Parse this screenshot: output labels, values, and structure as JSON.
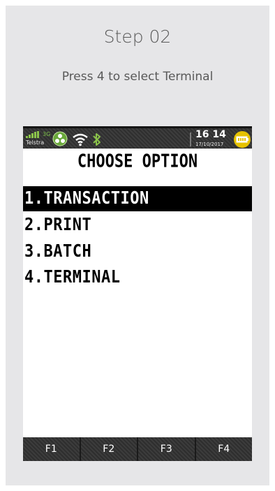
{
  "step": {
    "title": "Step 02",
    "description": "Press 4 to select Terminal"
  },
  "status_bar": {
    "carrier": "Telstra",
    "network_type": "3G",
    "time": "16 14",
    "date": "17/10/2017",
    "icons": [
      "signal-icon",
      "network-badge-icon",
      "wifi-icon",
      "bluetooth-icon",
      "battery-icon"
    ],
    "colors": {
      "bar": "#333333",
      "accent": "#8bc34a",
      "battery": "#e6c200"
    }
  },
  "menu": {
    "title": "CHOOSE OPTION",
    "items": [
      {
        "label": "1.TRANSACTION",
        "selected": true
      },
      {
        "label": "2.PRINT",
        "selected": false
      },
      {
        "label": "3.BATCH",
        "selected": false
      },
      {
        "label": "4.TERMINAL",
        "selected": false
      }
    ]
  },
  "function_keys": [
    "F1",
    "F2",
    "F3",
    "F4"
  ]
}
